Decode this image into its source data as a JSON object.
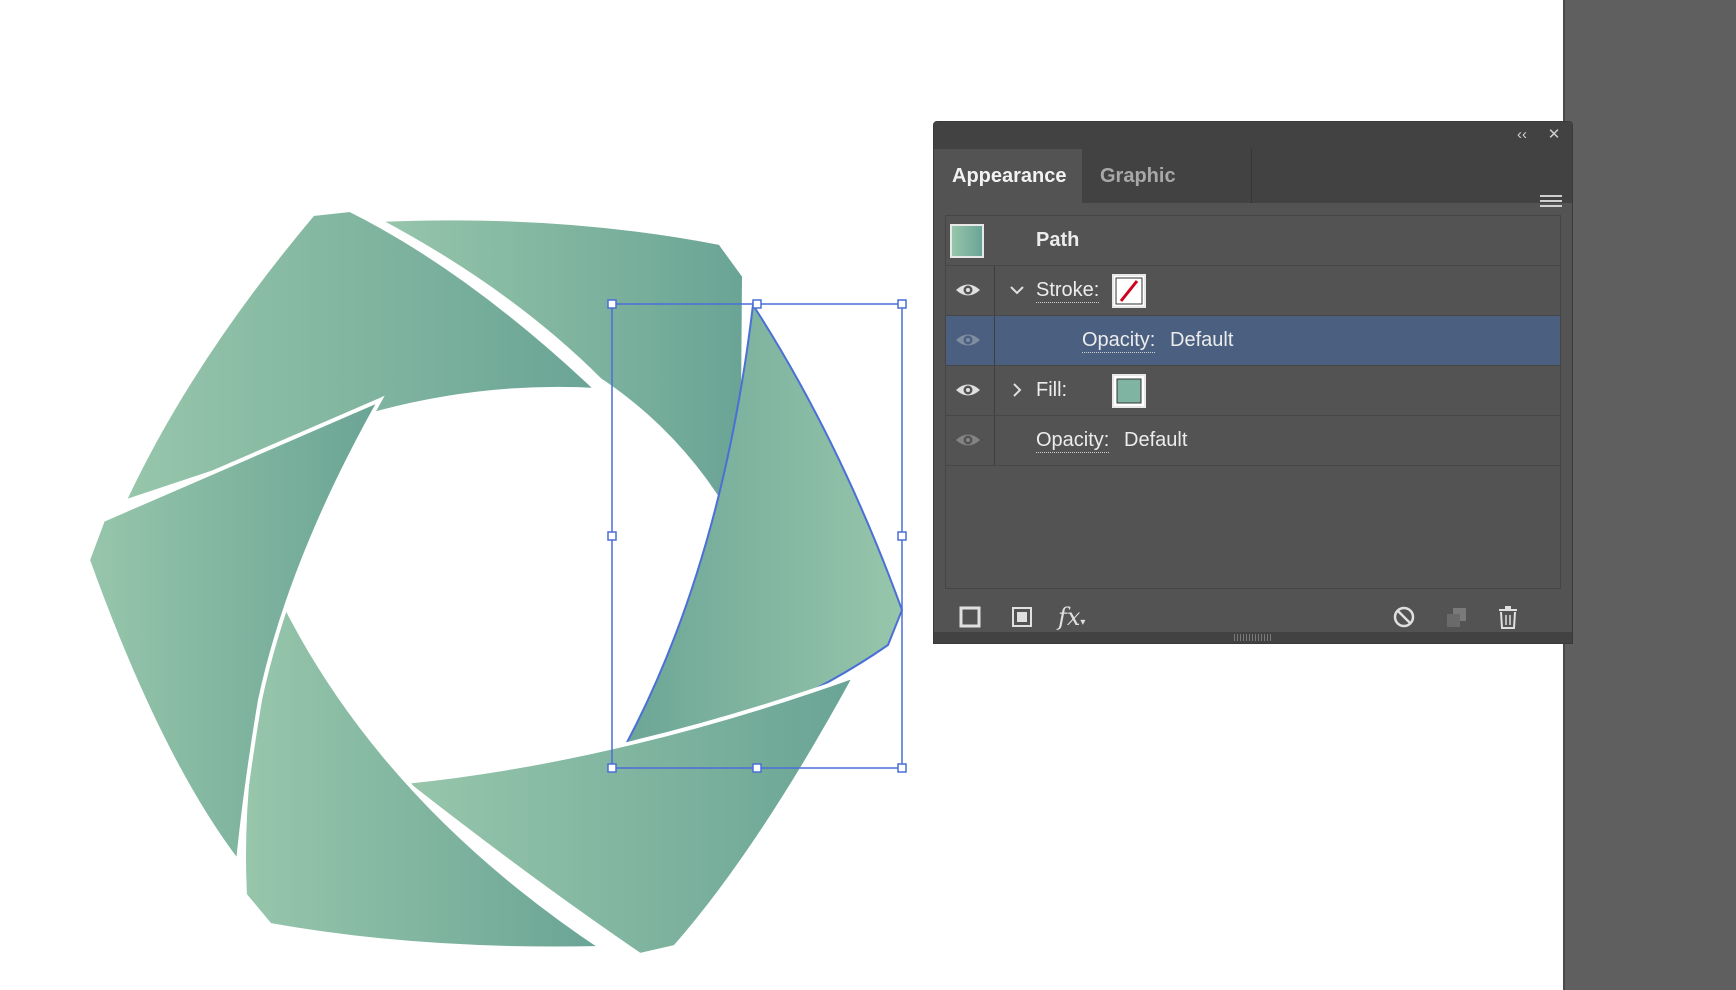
{
  "panel": {
    "tabs": [
      {
        "label": "Appearance",
        "active": true
      },
      {
        "label": "Graphic Styles",
        "active": false
      }
    ],
    "titlebar": {
      "collapse_icon": "double-chevron-left-icon",
      "close_icon": "close-icon"
    },
    "menu_icon": "hamburger-menu-icon"
  },
  "appearance": {
    "header": {
      "label": "Path"
    },
    "rows": [
      {
        "label": "Stroke:",
        "state": "expanded",
        "swatch": "none"
      },
      {
        "label": "Opacity:",
        "value": "Default",
        "selected": true
      },
      {
        "label": "Fill:",
        "state": "collapsed",
        "swatch": "#7fb3a2"
      },
      {
        "label": "Opacity:",
        "value": "Default"
      }
    ]
  },
  "footer": {
    "icons": [
      "add-new-stroke-icon",
      "add-new-fill-icon",
      "add-new-effect-icon",
      "clear-appearance-icon",
      "duplicate-item-icon",
      "delete-item-icon"
    ],
    "fx_label": "fx"
  },
  "colors": {
    "art_light": "#97c6ab",
    "art_dark": "#6aa495",
    "selection": "#4a6fd6",
    "panel_bg": "#535353",
    "panel_dark": "#424242",
    "row_selected": "#4b6080"
  }
}
